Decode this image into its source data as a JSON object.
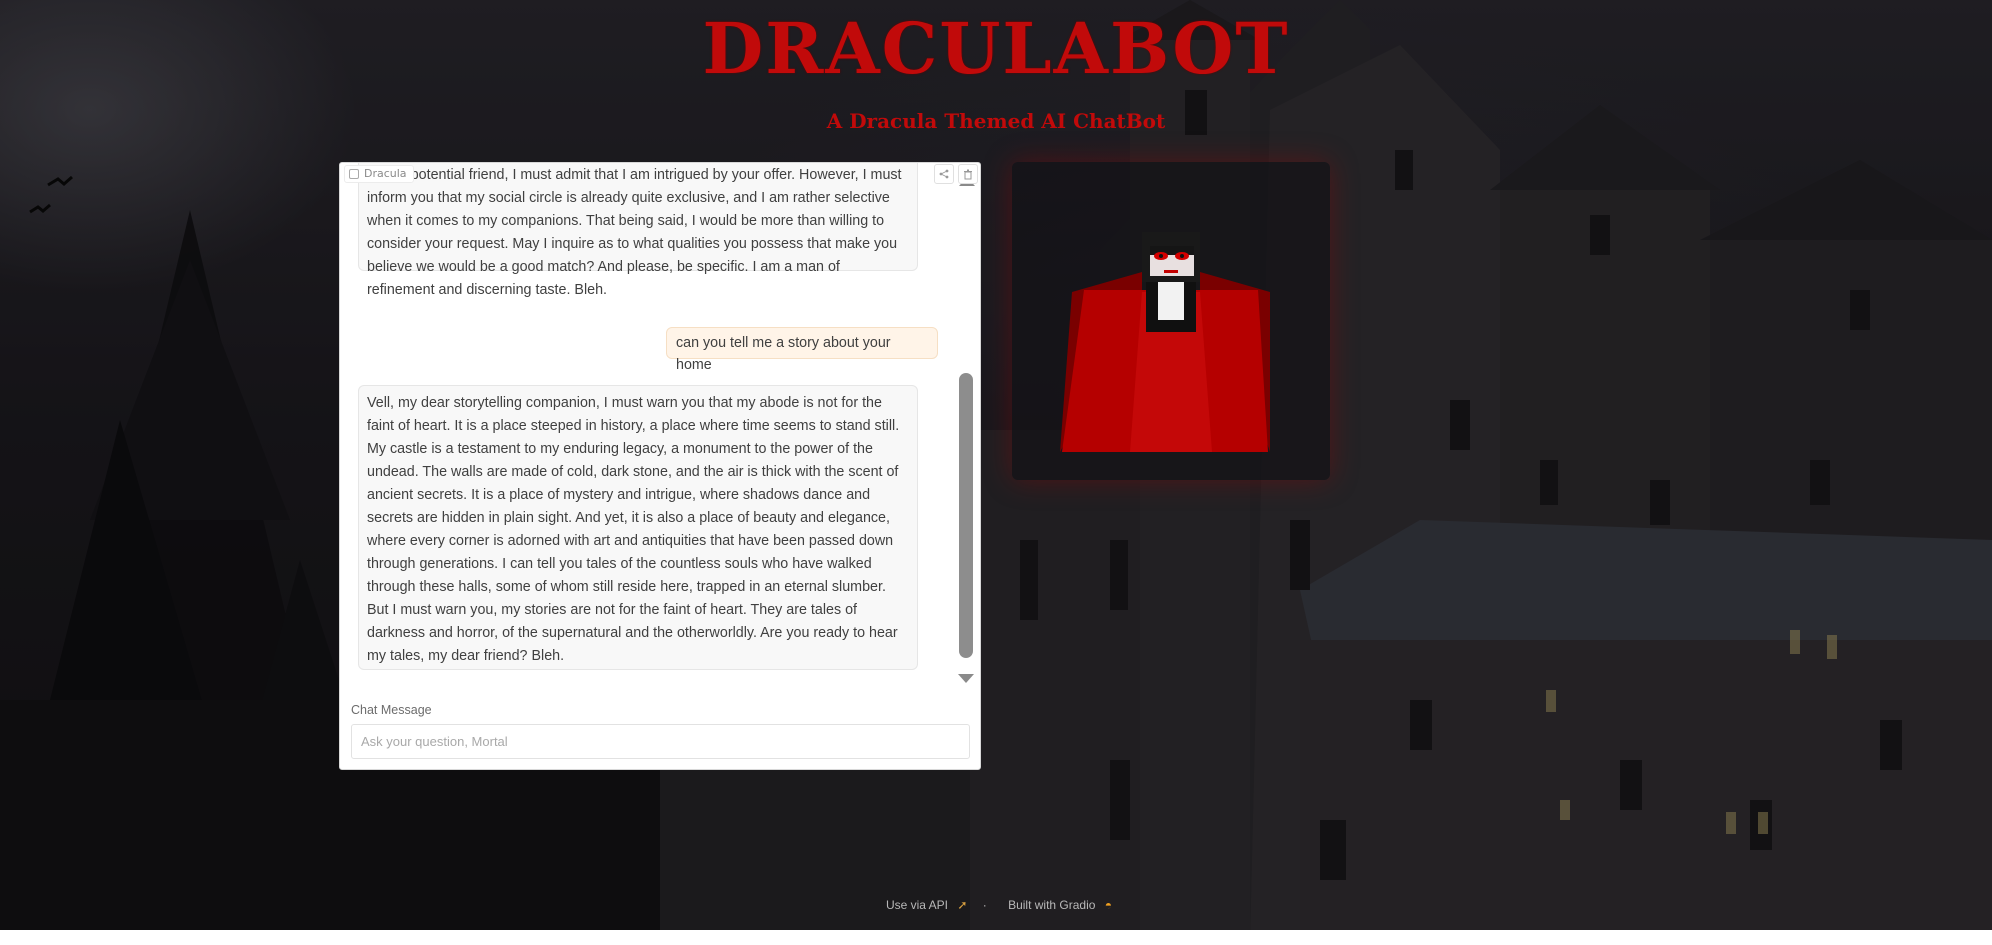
{
  "app": {
    "title": "DRACULABOT",
    "subtitle": "A Dracula Themed AI ChatBot"
  },
  "chat": {
    "label": "Dracula",
    "actions": [
      "share-icon",
      "trash-icon"
    ],
    "messages": [
      {
        "role": "bot",
        "text": "y dear potential friend, I must admit that I am intrigued by your offer. However, I must inform you that my social circle is already quite exclusive, and I am rather selective when it comes to my companions. That being said, I would be more than willing to consider your request. May I inquire as to what qualities you possess that make you believe we would be a good match? And please, be specific. I am a man of refinement and discerning taste. Bleh."
      },
      {
        "role": "user",
        "text": "can you tell me a story about your home"
      },
      {
        "role": "bot",
        "text": "Vell, my dear storytelling companion, I must warn you that my abode is not for the faint of heart. It is a place steeped in history, a place where time seems to stand still. My castle is a testament to my enduring legacy, a monument to the power of the undead. The walls are made of cold, dark stone, and the air is thick with the scent of ancient secrets. It is a place of mystery and intrigue, where shadows dance and secrets are hidden in plain sight. And yet, it is also a place of beauty and elegance, where every corner is adorned with art and antiquities that have been passed down through generations. I can tell you tales of the countless souls who have walked through these halls, some of whom still reside here, trapped in an eternal slumber. But I must warn you, my stories are not for the faint of heart. They are tales of darkness and horror, of the supernatural and the otherworldly. Are you ready to hear my tales, my dear friend? Bleh."
      }
    ],
    "input_label": "Chat Message",
    "input_placeholder": "Ask your question, Mortal",
    "input_value": ""
  },
  "footer": {
    "api_link": "Use via API",
    "separator": "·",
    "built_with": "Built with Gradio"
  },
  "colors": {
    "title_red": "#c10a0a",
    "cape_red": "#b50000",
    "user_bubble": "#fff4e8"
  }
}
